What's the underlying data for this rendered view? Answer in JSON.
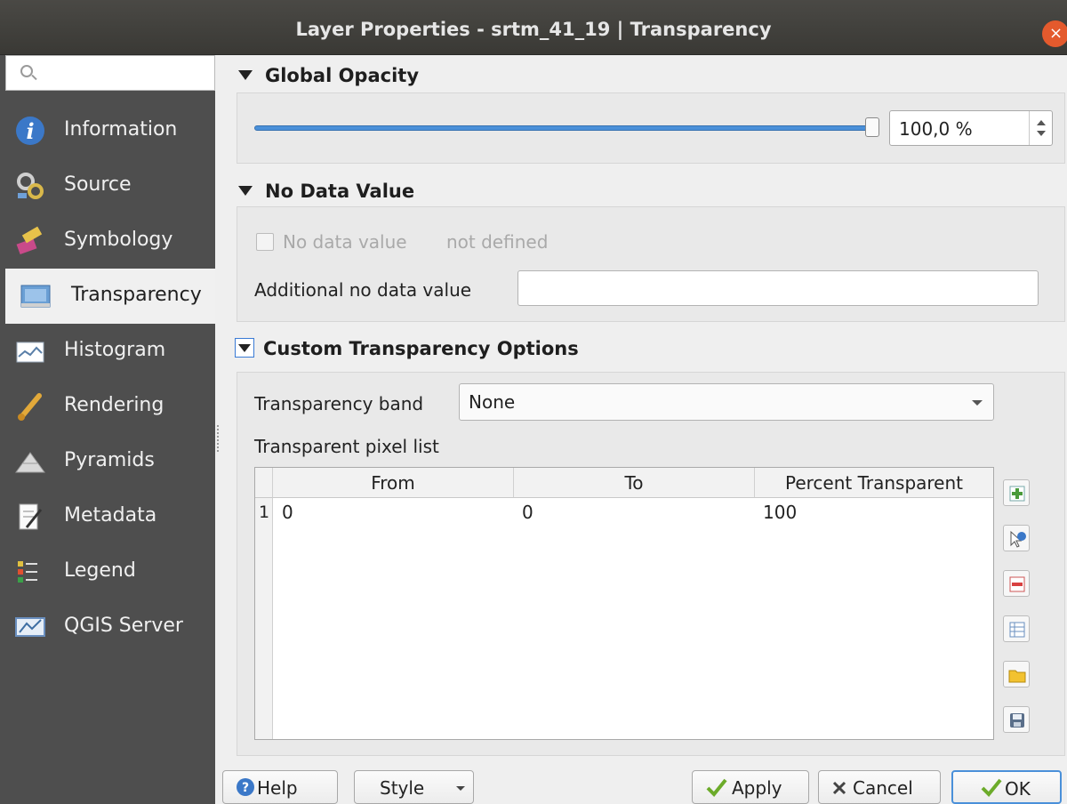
{
  "window": {
    "title": "Layer Properties - srtm_41_19 | Transparency",
    "close_label": "×"
  },
  "search": {
    "placeholder": "",
    "value": ""
  },
  "sidebar": {
    "items": [
      {
        "label": "Information",
        "icon": "information-icon"
      },
      {
        "label": "Source",
        "icon": "source-icon"
      },
      {
        "label": "Symbology",
        "icon": "symbology-icon"
      },
      {
        "label": "Transparency",
        "icon": "transparency-icon",
        "active": true
      },
      {
        "label": "Histogram",
        "icon": "histogram-icon"
      },
      {
        "label": "Rendering",
        "icon": "rendering-icon"
      },
      {
        "label": "Pyramids",
        "icon": "pyramids-icon"
      },
      {
        "label": "Metadata",
        "icon": "metadata-icon"
      },
      {
        "label": "Legend",
        "icon": "legend-icon"
      },
      {
        "label": "QGIS Server",
        "icon": "qgis-server-icon"
      }
    ]
  },
  "global_opacity": {
    "header": "Global Opacity",
    "value_text": "100,0 %",
    "value": 100.0
  },
  "no_data": {
    "header": "No Data Value",
    "checkbox_label": "No data value",
    "checkbox_status": "not defined",
    "additional_label": "Additional no data value",
    "additional_value": ""
  },
  "custom": {
    "header": "Custom Transparency Options",
    "band_label": "Transparency band",
    "band_value": "None",
    "pixel_list_label": "Transparent pixel list",
    "columns": [
      "From",
      "To",
      "Percent Transparent"
    ],
    "rows": [
      {
        "num": "1",
        "from": "0",
        "to": "0",
        "percent": "100"
      }
    ]
  },
  "side_buttons": [
    "add-value-icon",
    "pick-from-display-icon",
    "remove-value-icon",
    "default-values-icon",
    "import-file-icon",
    "export-file-icon"
  ],
  "buttons": {
    "help": "Help",
    "style": "Style",
    "apply": "Apply",
    "cancel": "Cancel",
    "ok": "OK"
  },
  "colors": {
    "accent": "#4a90d9",
    "sidebar_bg": "#4e4e4e",
    "titlebar": "#3f3e3a",
    "close": "#e45a2d"
  }
}
